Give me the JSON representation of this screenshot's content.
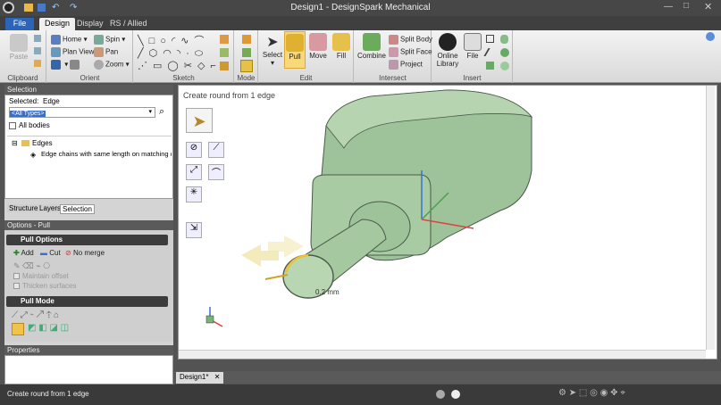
{
  "window": {
    "title": "Design1 - DesignSpark Mechanical"
  },
  "tabs": {
    "file": "File",
    "design": "Design",
    "display": "Display",
    "rs": "RS / Allied"
  },
  "ribbon": {
    "clipboard": {
      "paste": "Paste",
      "label": "Clipboard"
    },
    "orient": {
      "home": "Home",
      "spin": "Spin",
      "plan": "Plan View",
      "pan": "Pan",
      "zoom": "Zoom",
      "label": "Orient"
    },
    "sketch": {
      "label": "Sketch"
    },
    "mode": {
      "label": "Mode"
    },
    "edit": {
      "select": "Select",
      "pull": "Pull",
      "move": "Move",
      "fill": "Fill",
      "label": "Edit"
    },
    "intersect": {
      "combine": "Combine",
      "split_body": "Split Body",
      "split_face": "Split Face",
      "project": "Project",
      "label": "Intersect"
    },
    "insert": {
      "online": "Online",
      "library": "Library",
      "file": "File",
      "label": "Insert"
    }
  },
  "selection_panel": {
    "header": "Selection",
    "selected_label": "Selected:",
    "selected_value": "Edge",
    "type_value": "<All Types>",
    "all_bodies": "All bodies",
    "tree_root": "Edges",
    "tree_child": "Edge chains with same length on matching con"
  },
  "panel_tabs": {
    "structure": "Structure",
    "layers": "Layers",
    "selection": "Selection"
  },
  "options": {
    "header": "Options - Pull",
    "pull_options": "Pull Options",
    "add": "Add",
    "cut": "Cut",
    "no_merge": "No merge",
    "maintain_offset": "Maintain offset",
    "thicken": "Thicken surfaces",
    "pull_mode": "Pull Mode"
  },
  "properties": {
    "header": "Properties"
  },
  "viewport": {
    "hint": "Create round from 1 edge",
    "dimension": "0.2 mm"
  },
  "doc_tab": {
    "label": "Design1*"
  },
  "status": {
    "text": "Create round from 1 edge"
  }
}
